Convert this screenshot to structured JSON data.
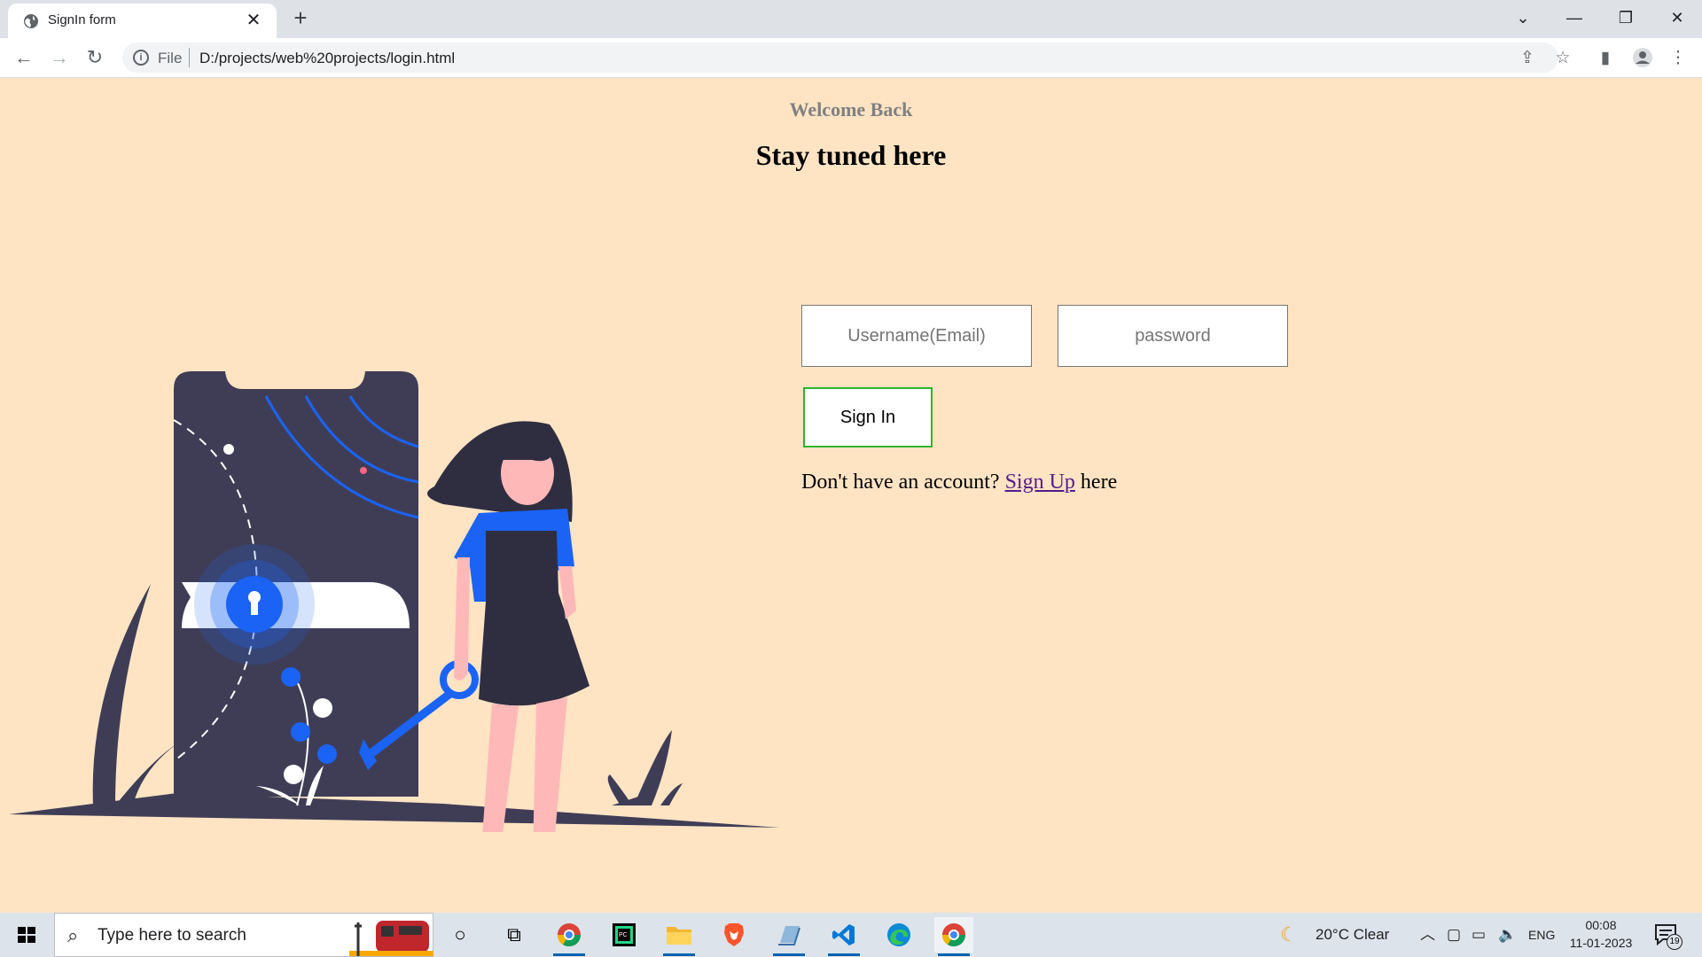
{
  "browser": {
    "tab_title": "SignIn form",
    "tab_close": "✕",
    "new_tab": "+",
    "scheme": "File",
    "url": "D:/projects/web%20projects/login.html",
    "window_controls": [
      "⌄",
      "—",
      "❐",
      "✕"
    ]
  },
  "page": {
    "welcome": "Welcome Back",
    "tagline": "Stay tuned here",
    "username_placeholder": "Username(Email)",
    "password_placeholder": "password",
    "signin_label": "Sign In",
    "account_prefix": "Don't have an account?",
    "signup_link": "Sign Up",
    "account_suffix": "here"
  },
  "taskbar": {
    "search_placeholder": "Type here to search",
    "weather": "20°C  Clear",
    "language": "ENG",
    "time": "00:08",
    "date": "11-01-2023",
    "notification_count": "19"
  },
  "colors": {
    "page_bg": "#ffe4c4",
    "accent_blue": "#1a63f5",
    "phone_dark": "#3f3d56",
    "signin_border": "#2db52d",
    "link": "#551a8b"
  }
}
